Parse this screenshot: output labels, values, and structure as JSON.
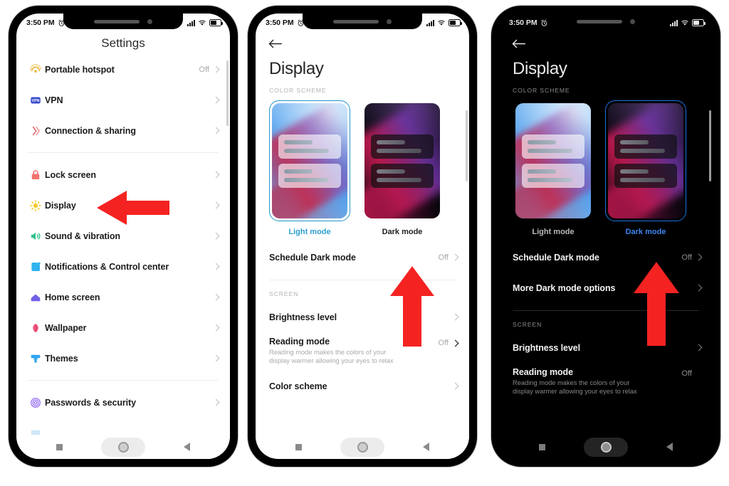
{
  "accent": {
    "red_arrow": "#f52222",
    "light_sel": "#2196c9",
    "dark_sel": "#1a73e8"
  },
  "status_bar": {
    "time": "3:50 PM",
    "alarm_icon": "alarm-icon",
    "signal_icon": "signal-bars-icon",
    "wifi_icon": "wifi-icon",
    "battery_icon": "battery-icon"
  },
  "nav_bar": {
    "recents": "recents-square-icon",
    "home": "home-circle-icon",
    "back": "back-triangle-icon"
  },
  "phone1": {
    "title": "Settings",
    "rows_top": [
      {
        "label": "Portable hotspot",
        "value": "Off",
        "icon": "hotspot-icon"
      },
      {
        "label": "VPN",
        "value": "",
        "icon": "vpn-icon"
      },
      {
        "label": "Connection & sharing",
        "value": "",
        "icon": "connection-sharing-icon"
      }
    ],
    "rows_mid": [
      {
        "label": "Lock screen",
        "value": "",
        "icon": "lock-icon"
      },
      {
        "label": "Display",
        "value": "",
        "icon": "brightness-sun-icon"
      },
      {
        "label": "Sound & vibration",
        "value": "",
        "icon": "speaker-icon"
      },
      {
        "label": "Notifications & Control center",
        "value": "",
        "icon": "notifications-icon"
      },
      {
        "label": "Home screen",
        "value": "",
        "icon": "home-icon"
      },
      {
        "label": "Wallpaper",
        "value": "",
        "icon": "wallpaper-flower-icon"
      },
      {
        "label": "Themes",
        "value": "",
        "icon": "themes-brush-icon"
      }
    ],
    "rows_bottom": [
      {
        "label": "Passwords & security",
        "value": "",
        "icon": "fingerprint-icon"
      }
    ],
    "arrow": "left-arrow-pointing-to-display"
  },
  "phone2": {
    "back": "back-arrow-icon",
    "title": "Display",
    "section_color_scheme": "COLOR SCHEME",
    "schemes": [
      {
        "label": "Light mode",
        "selected": true
      },
      {
        "label": "Dark mode",
        "selected": false
      }
    ],
    "rows": [
      {
        "label": "Schedule Dark mode",
        "value": "Off"
      }
    ],
    "section_screen": "SCREEN",
    "rows2": [
      {
        "label": "Brightness level",
        "sub": "",
        "value": ""
      },
      {
        "label": "Reading mode",
        "sub": "Reading mode makes the colors of your display warmer allowing your eyes to relax",
        "value": "Off"
      },
      {
        "label": "Color scheme",
        "sub": "",
        "value": ""
      }
    ],
    "arrow": "up-arrow-pointing-to-dark-mode"
  },
  "phone3": {
    "back": "back-arrow-icon",
    "title": "Display",
    "section_color_scheme": "COLOR SCHEME",
    "schemes": [
      {
        "label": "Light mode",
        "selected": false
      },
      {
        "label": "Dark mode",
        "selected": true
      }
    ],
    "rows": [
      {
        "label": "Schedule Dark mode",
        "value": "Off"
      },
      {
        "label": "More Dark mode options",
        "value": ""
      }
    ],
    "section_screen": "SCREEN",
    "rows2": [
      {
        "label": "Brightness level",
        "sub": "",
        "value": ""
      },
      {
        "label": "Reading mode",
        "sub": "Reading mode makes the colors of your display warmer allowing your eyes to relax",
        "value": "Off"
      }
    ],
    "arrow": "up-arrow-pointing-to-dark-mode"
  }
}
